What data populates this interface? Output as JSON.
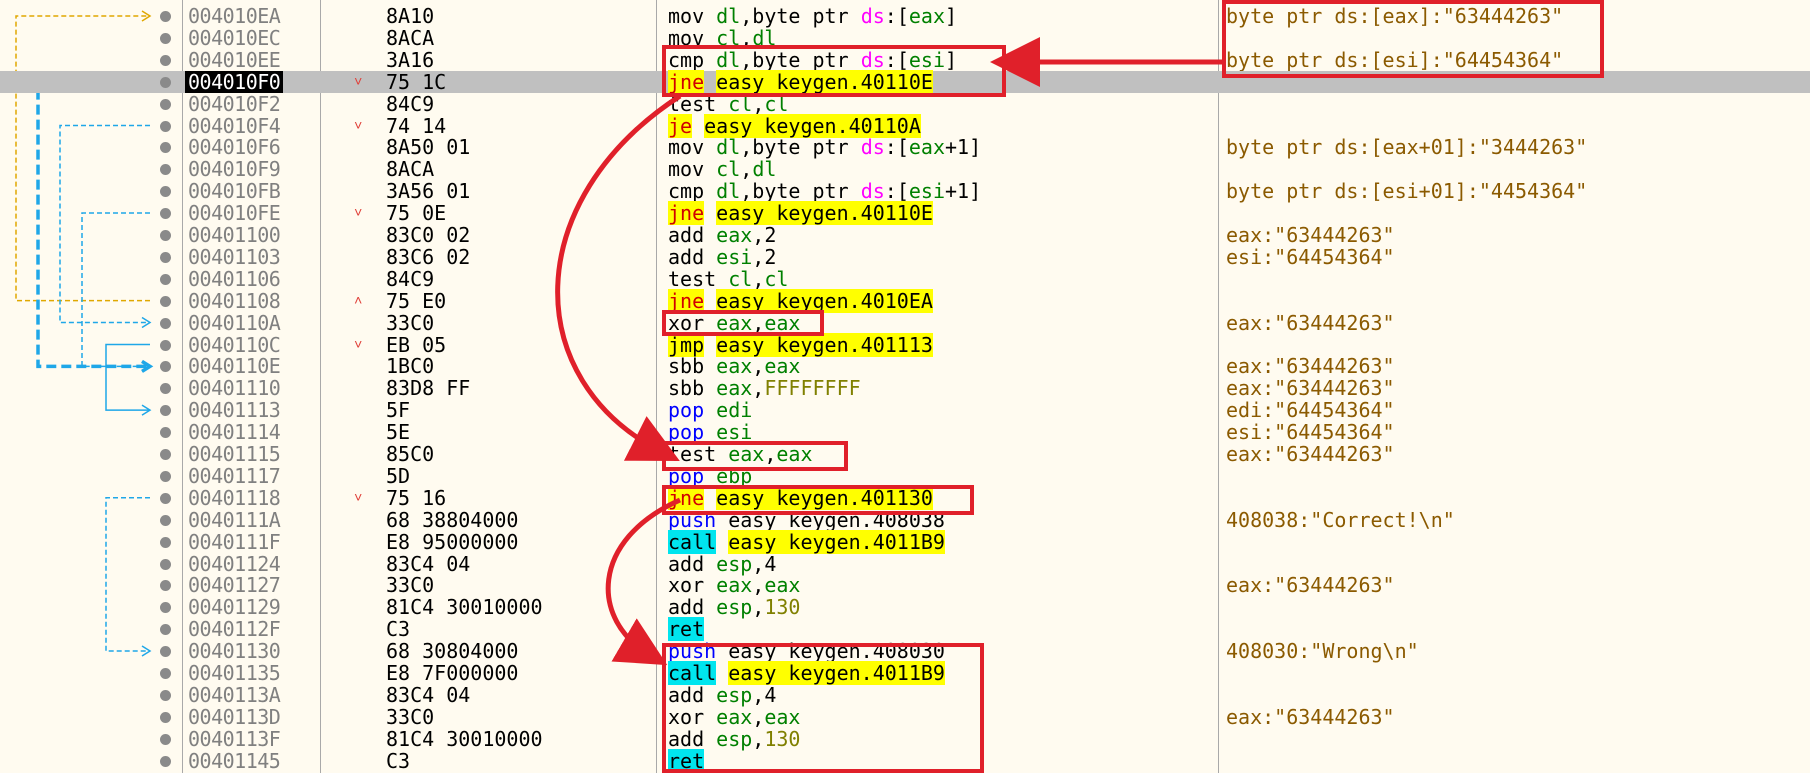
{
  "colors": {
    "red_annotation": "#e0202a",
    "current_row_bg": "#c0c0c0",
    "yellow_jump": "#ffff00",
    "cyan_call": "#00e5ee",
    "register": "#008000",
    "comment": "#8b5a00"
  },
  "rows": [
    {
      "addr": "004010EA",
      "bytes": "8A10",
      "mark": "",
      "mnem": "mov",
      "ops": "dl,byte ptr ds:[eax]",
      "kind": "mov",
      "comment": "byte ptr ds:[eax]:\"63444263\""
    },
    {
      "addr": "004010EC",
      "bytes": "8ACA",
      "mark": "",
      "mnem": "mov",
      "ops": "cl,dl",
      "kind": "mov",
      "comment": ""
    },
    {
      "addr": "004010EE",
      "bytes": "3A16",
      "mark": "",
      "mnem": "cmp",
      "ops": "dl,byte ptr ds:[esi]",
      "kind": "mov",
      "comment": "byte ptr ds:[esi]:\"64454364\""
    },
    {
      "addr": "004010F0",
      "bytes": "75 1C",
      "mark": "˅",
      "mnem": "jne",
      "ops": "easy keygen.40110E",
      "kind": "jcc",
      "comment": ""
    },
    {
      "addr": "004010F2",
      "bytes": "84C9",
      "mark": "",
      "mnem": "test",
      "ops": "cl,cl",
      "kind": "mov",
      "comment": ""
    },
    {
      "addr": "004010F4",
      "bytes": "74 14",
      "mark": "˅",
      "mnem": "je",
      "ops": "easy keygen.40110A",
      "kind": "jcc",
      "comment": ""
    },
    {
      "addr": "004010F6",
      "bytes": "8A50 01",
      "mark": "",
      "mnem": "mov",
      "ops": "dl,byte ptr ds:[eax+1]",
      "kind": "mov",
      "comment": "byte ptr ds:[eax+01]:\"3444263\""
    },
    {
      "addr": "004010F9",
      "bytes": "8ACA",
      "mark": "",
      "mnem": "mov",
      "ops": "cl,dl",
      "kind": "mov",
      "comment": ""
    },
    {
      "addr": "004010FB",
      "bytes": "3A56 01",
      "mark": "",
      "mnem": "cmp",
      "ops": "dl,byte ptr ds:[esi+1]",
      "kind": "mov",
      "comment": "byte ptr ds:[esi+01]:\"4454364\""
    },
    {
      "addr": "004010FE",
      "bytes": "75 0E",
      "mark": "˅",
      "mnem": "jne",
      "ops": "easy keygen.40110E",
      "kind": "jcc",
      "comment": ""
    },
    {
      "addr": "00401100",
      "bytes": "83C0 02",
      "mark": "",
      "mnem": "add",
      "ops": "eax,2",
      "kind": "mov",
      "comment": "eax:\"63444263\""
    },
    {
      "addr": "00401103",
      "bytes": "83C6 02",
      "mark": "",
      "mnem": "add",
      "ops": "esi,2",
      "kind": "mov",
      "comment": "esi:\"64454364\""
    },
    {
      "addr": "00401106",
      "bytes": "84C9",
      "mark": "",
      "mnem": "test",
      "ops": "cl,cl",
      "kind": "mov",
      "comment": ""
    },
    {
      "addr": "00401108",
      "bytes": "75 E0",
      "mark": "˄",
      "mnem": "jne",
      "ops": "easy keygen.4010EA",
      "kind": "jcc",
      "comment": ""
    },
    {
      "addr": "0040110A",
      "bytes": "33C0",
      "mark": "",
      "mnem": "xor",
      "ops": "eax,eax",
      "kind": "mov",
      "comment": "eax:\"63444263\""
    },
    {
      "addr": "0040110C",
      "bytes": "EB 05",
      "mark": "˅",
      "mnem": "jmp",
      "ops": "easy keygen.401113",
      "kind": "jmp",
      "comment": ""
    },
    {
      "addr": "0040110E",
      "bytes": "1BC0",
      "mark": "",
      "mnem": "sbb",
      "ops": "eax,eax",
      "kind": "mov",
      "comment": "eax:\"63444263\""
    },
    {
      "addr": "00401110",
      "bytes": "83D8 FF",
      "mark": "",
      "mnem": "sbb",
      "ops": "eax,FFFFFFFF",
      "kind": "mov",
      "comment": "eax:\"63444263\""
    },
    {
      "addr": "00401113",
      "bytes": "5F",
      "mark": "",
      "mnem": "pop",
      "ops": "edi",
      "kind": "pop",
      "comment": "edi:\"64454364\""
    },
    {
      "addr": "00401114",
      "bytes": "5E",
      "mark": "",
      "mnem": "pop",
      "ops": "esi",
      "kind": "pop",
      "comment": "esi:\"64454364\""
    },
    {
      "addr": "00401115",
      "bytes": "85C0",
      "mark": "",
      "mnem": "test",
      "ops": "eax,eax",
      "kind": "mov",
      "comment": "eax:\"63444263\""
    },
    {
      "addr": "00401117",
      "bytes": "5D",
      "mark": "",
      "mnem": "pop",
      "ops": "ebp",
      "kind": "pop",
      "comment": ""
    },
    {
      "addr": "00401118",
      "bytes": "75 16",
      "mark": "˅",
      "mnem": "jne",
      "ops": "easy keygen.401130",
      "kind": "jcc",
      "comment": ""
    },
    {
      "addr": "0040111A",
      "bytes": "68 38804000",
      "mark": "",
      "mnem": "push",
      "ops": "easy keygen.408038",
      "kind": "push",
      "comment": "408038:\"Correct!\\n\""
    },
    {
      "addr": "0040111F",
      "bytes": "E8 95000000",
      "mark": "",
      "mnem": "call",
      "ops": "easy keygen.4011B9",
      "kind": "call",
      "comment": ""
    },
    {
      "addr": "00401124",
      "bytes": "83C4 04",
      "mark": "",
      "mnem": "add",
      "ops": "esp,4",
      "kind": "mov",
      "comment": ""
    },
    {
      "addr": "00401127",
      "bytes": "33C0",
      "mark": "",
      "mnem": "xor",
      "ops": "eax,eax",
      "kind": "mov",
      "comment": "eax:\"63444263\""
    },
    {
      "addr": "00401129",
      "bytes": "81C4 30010000",
      "mark": "",
      "mnem": "add",
      "ops": "esp,130",
      "kind": "mov",
      "comment": ""
    },
    {
      "addr": "0040112F",
      "bytes": "C3",
      "mark": "",
      "mnem": "ret",
      "ops": "",
      "kind": "ret",
      "comment": ""
    },
    {
      "addr": "00401130",
      "bytes": "68 30804000",
      "mark": "",
      "mnem": "push",
      "ops": "easy keygen.408030",
      "kind": "push",
      "comment": "408030:\"Wrong\\n\""
    },
    {
      "addr": "00401135",
      "bytes": "E8 7F000000",
      "mark": "",
      "mnem": "call",
      "ops": "easy keygen.4011B9",
      "kind": "call",
      "comment": ""
    },
    {
      "addr": "0040113A",
      "bytes": "83C4 04",
      "mark": "",
      "mnem": "add",
      "ops": "esp,4",
      "kind": "mov",
      "comment": ""
    },
    {
      "addr": "0040113D",
      "bytes": "33C0",
      "mark": "",
      "mnem": "xor",
      "ops": "eax,eax",
      "kind": "mov",
      "comment": "eax:\"63444263\""
    },
    {
      "addr": "0040113F",
      "bytes": "81C4 30010000",
      "mark": "",
      "mnem": "add",
      "ops": "esp,130",
      "kind": "mov",
      "comment": ""
    },
    {
      "addr": "00401145",
      "bytes": "C3",
      "mark": "",
      "mnem": "ret",
      "ops": "",
      "kind": "ret",
      "comment": ""
    }
  ],
  "current_address": "004010F0"
}
